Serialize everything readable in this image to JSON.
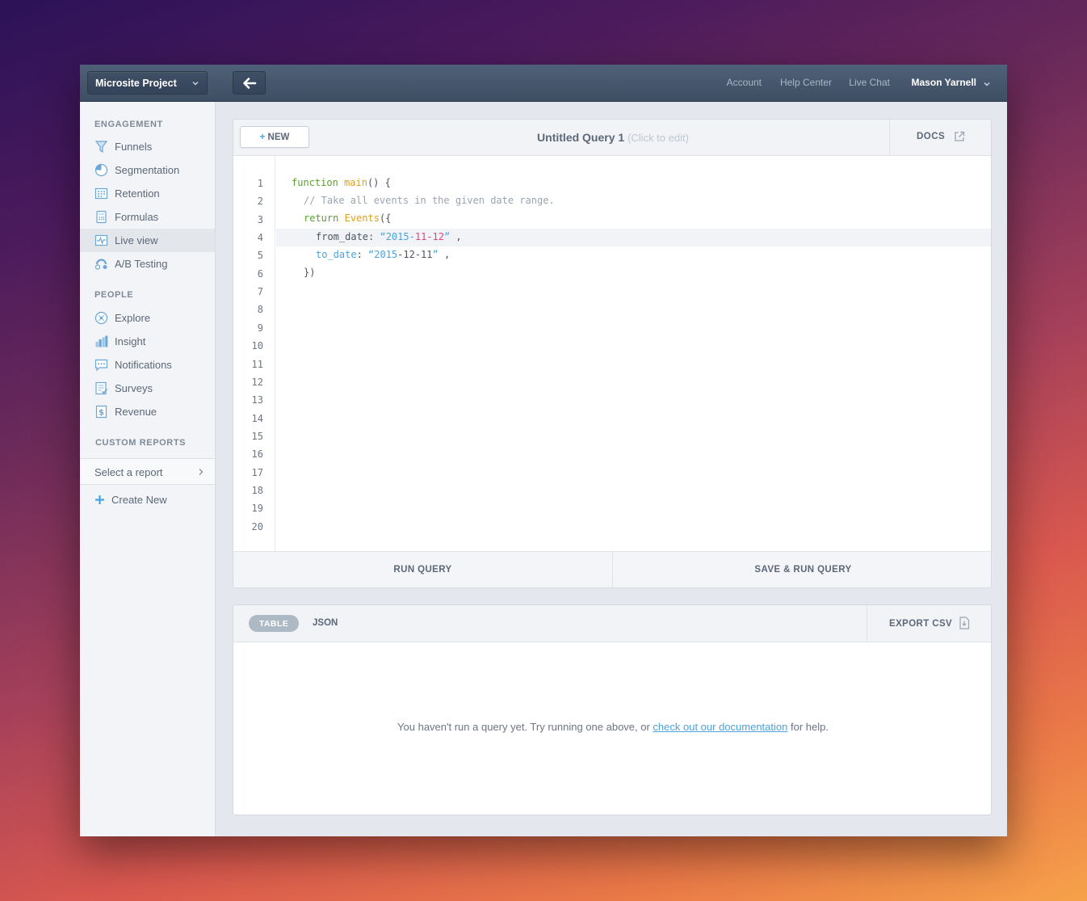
{
  "topbar": {
    "project": "Microsite Project",
    "links": [
      "Account",
      "Help Center",
      "Live Chat"
    ],
    "user": "Mason Yarnell"
  },
  "sidebar": {
    "engagement_heading": "ENGAGEMENT",
    "engagement": [
      {
        "label": "Funnels",
        "icon": "funnel-icon"
      },
      {
        "label": "Segmentation",
        "icon": "pie-chart-icon"
      },
      {
        "label": "Retention",
        "icon": "calendar-grid-icon"
      },
      {
        "label": "Formulas",
        "icon": "calculator-icon"
      },
      {
        "label": "Live view",
        "icon": "pulse-icon",
        "active": true
      },
      {
        "label": "A/B Testing",
        "icon": "ab-test-icon"
      }
    ],
    "people_heading": "PEOPLE",
    "people": [
      {
        "label": "Explore",
        "icon": "compass-icon"
      },
      {
        "label": "Insight",
        "icon": "bar-chart-icon"
      },
      {
        "label": "Notifications",
        "icon": "chat-bubble-icon"
      },
      {
        "label": "Surveys",
        "icon": "checklist-icon"
      },
      {
        "label": "Revenue",
        "icon": "dollar-icon"
      }
    ],
    "custom_heading": "CUSTOM REPORTS",
    "report_select": "Select a report",
    "create_new": "Create New"
  },
  "editor": {
    "new_button": "NEW",
    "new_plus": "+",
    "title": "Untitled Query 1",
    "title_hint": "(Click to edit)",
    "docs": "DOCS",
    "line_numbers": [
      "1",
      "2",
      "3",
      "4",
      "5",
      "6",
      "7",
      "8",
      "9",
      "10",
      "11",
      "12",
      "13",
      "14",
      "15",
      "16",
      "17",
      "18",
      "19",
      "20"
    ],
    "code": {
      "l1_kw": "function",
      "l1_fn": "main",
      "l1_rest": "() {",
      "l2_comment": "// Take all events in the given date range.",
      "l3_kw": "return",
      "l3_fn": "Events",
      "l3_rest": "({",
      "l4_key": "from_date",
      "l4_colon": ": ",
      "l4_str_a": "“2015-",
      "l4_num": "11-12",
      "l4_str_b": "”",
      "l4_comma": " ,",
      "l5_key": "to_date",
      "l5_colon": ": ",
      "l5_str_a": "“2015",
      "l5_mid": "-12-11",
      "l5_str_b": "”",
      "l5_comma": " ,",
      "l6": "})"
    },
    "run": "RUN QUERY",
    "save_run": "SAVE & RUN QUERY"
  },
  "results": {
    "tab_table": "TABLE",
    "tab_json": "JSON",
    "export": "EXPORT CSV",
    "empty_before": "You haven't run a query yet. Try running one above, or ",
    "empty_link": "check out our documentation",
    "empty_after": " for help."
  },
  "colors": {
    "accent": "#4ba3dd",
    "keyword": "#5aa02c",
    "function": "#e1a020",
    "number": "#e0457b"
  }
}
